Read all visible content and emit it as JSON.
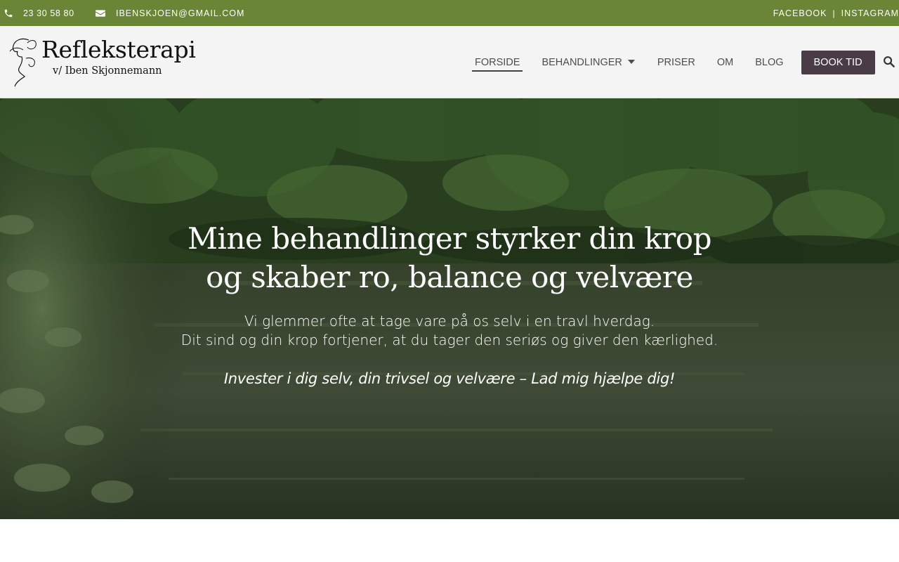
{
  "topbar": {
    "phone": "23 30 58 80",
    "email": "IBENSKJOEN@GMAIL.COM",
    "social": {
      "facebook": "FACEBOOK",
      "separator": "|",
      "instagram": "INSTAGRAM"
    },
    "background_color": "#6b8536"
  },
  "header": {
    "logo": {
      "title": "Refleksterapi",
      "subtitle": "v/ Iben Skjonnemann"
    },
    "nav": {
      "items": [
        {
          "label": "FORSIDE",
          "active": true
        },
        {
          "label": "BEHANDLINGER",
          "has_dropdown": true
        },
        {
          "label": "PRISER"
        },
        {
          "label": "OM"
        },
        {
          "label": "BLOG"
        }
      ],
      "cta": "BOOK TID",
      "cta_color": "#4a3c47"
    },
    "search_icon": "search-icon"
  },
  "hero": {
    "heading_line1": "Mine behandlinger styrker din krop",
    "heading_line2": "og skaber ro, balance og velvære",
    "sub_line1": "Vi glemmer ofte at tage vare på os selv i en travl hverdag.",
    "sub_line2": "Dit sind og din krop fortjener, at du tager den seriøs og giver den kærlighed.",
    "tagline": "Invester i dig selv, din trivsel og velvære – Lad mig hjælpe dig!"
  }
}
